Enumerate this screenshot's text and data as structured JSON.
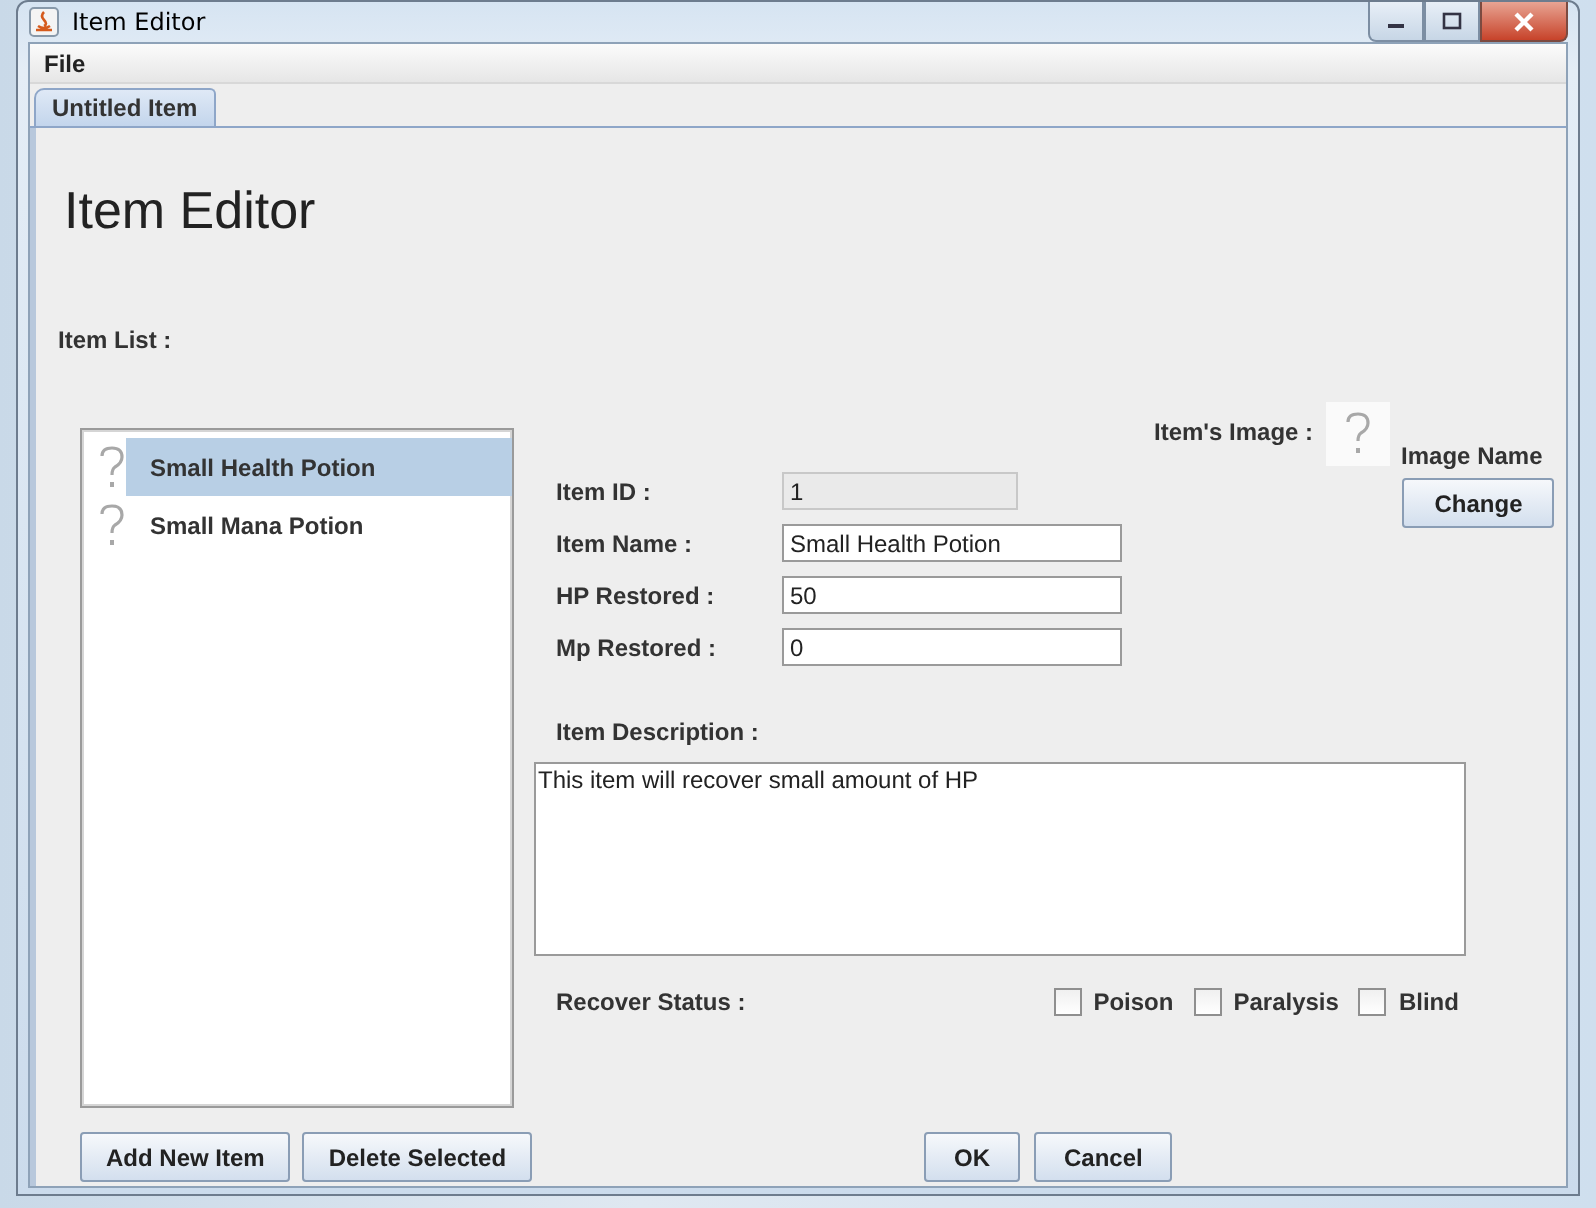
{
  "window": {
    "title": "Item Editor"
  },
  "menu": [
    "File"
  ],
  "tabs": [
    {
      "label": "Untitled Item",
      "selected": true
    }
  ],
  "heading": "Item Editor",
  "item_list": {
    "label": "Item List :",
    "items": [
      {
        "name": "Small Health Potion",
        "selected": true
      },
      {
        "name": "Small Mana Potion",
        "selected": false
      }
    ],
    "buttons": [
      "Add New Item",
      "Delete Selected"
    ]
  },
  "fields": [
    {
      "label": "Item ID :",
      "value": "1",
      "disabled": true
    },
    {
      "label": "Item Name :",
      "value": "Small Health Potion",
      "disabled": false
    },
    {
      "label": "HP Restored :",
      "value": "50",
      "disabled": false
    },
    {
      "label": "Mp Restored :",
      "value": "0",
      "disabled": false
    }
  ],
  "image": {
    "label": "Item's Image :",
    "name": "Image Name",
    "button": "Change"
  },
  "description": {
    "label": "Item Description :",
    "value": "This item will recover small amount of HP"
  },
  "recover_status": {
    "label": "Recover Status :",
    "options": [
      {
        "label": "Poison",
        "checked": false
      },
      {
        "label": "Paralysis",
        "checked": false
      },
      {
        "label": "Blind",
        "checked": false
      }
    ]
  },
  "dialog_buttons": [
    "OK",
    "Cancel"
  ]
}
